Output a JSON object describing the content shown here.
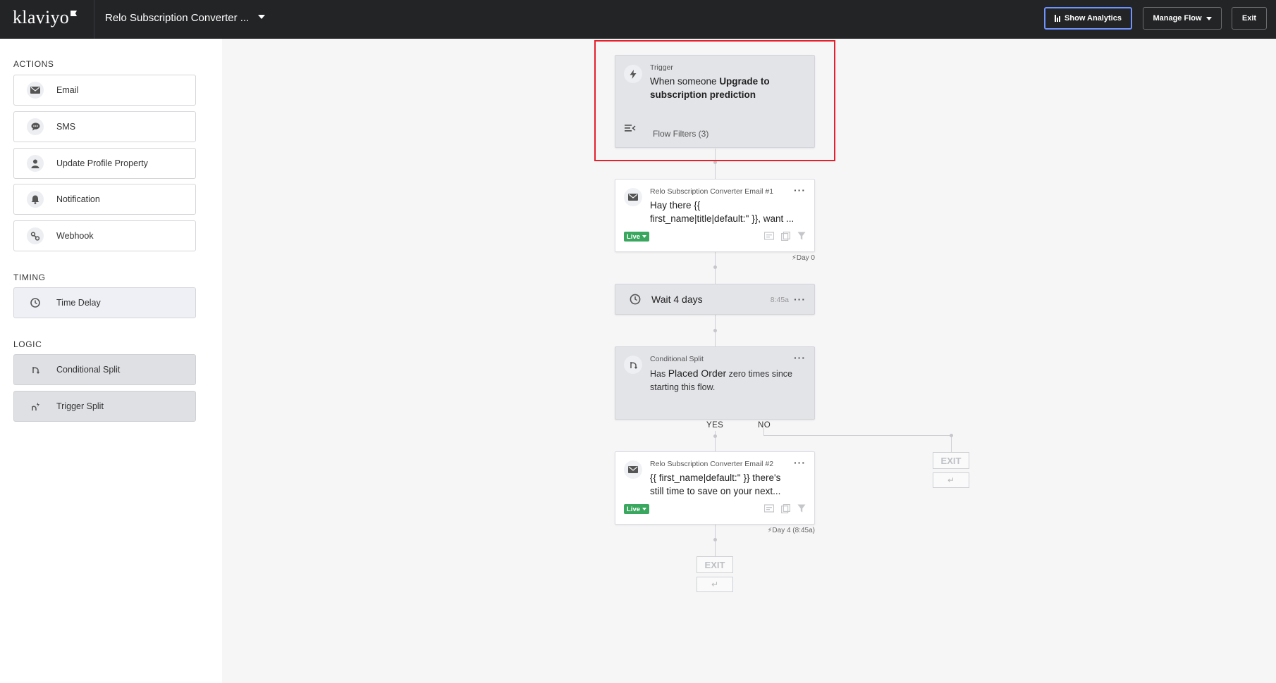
{
  "header": {
    "logo": "klaviyo",
    "flow_name": "Relo Subscription Converter ...",
    "show_analytics": "Show Analytics",
    "manage_flow": "Manage Flow",
    "exit": "Exit"
  },
  "sidebar": {
    "actions_heading": "ACTIONS",
    "actions": [
      {
        "label": "Email",
        "icon": "mail-icon"
      },
      {
        "label": "SMS",
        "icon": "chat-icon"
      },
      {
        "label": "Update Profile Property",
        "icon": "person-icon"
      },
      {
        "label": "Notification",
        "icon": "bell-icon"
      },
      {
        "label": "Webhook",
        "icon": "webhook-icon"
      }
    ],
    "timing_heading": "TIMING",
    "timing": [
      {
        "label": "Time Delay",
        "icon": "clock-icon"
      }
    ],
    "logic_heading": "LOGIC",
    "logic": [
      {
        "label": "Conditional Split",
        "icon": "split-icon"
      },
      {
        "label": "Trigger Split",
        "icon": "trigger-split-icon"
      }
    ]
  },
  "flow": {
    "trigger": {
      "label": "Trigger",
      "prefix": "When someone ",
      "event": "Upgrade to subscription prediction",
      "filters": "Flow Filters (3)"
    },
    "email1": {
      "label": "Relo Subscription Converter Email #1",
      "line1": "Hay there {{",
      "line2": "first_name|title|default:'' }}, want ...",
      "status": "Live",
      "day": "Day 0"
    },
    "wait": {
      "text": "Wait 4 days",
      "time": "8:45a"
    },
    "split": {
      "label": "Conditional Split",
      "pre": "Has ",
      "metric": "Placed Order",
      "post": " zero times since starting this flow.",
      "yes": "YES",
      "no": "NO"
    },
    "email2": {
      "label": "Relo Subscription Converter Email #2",
      "line1": "{{ first_name|default:'' }} there's",
      "line2": "still time to save on your next...",
      "status": "Live",
      "day": "Day 4 (8:45a)"
    },
    "exit_label": "EXIT"
  }
}
